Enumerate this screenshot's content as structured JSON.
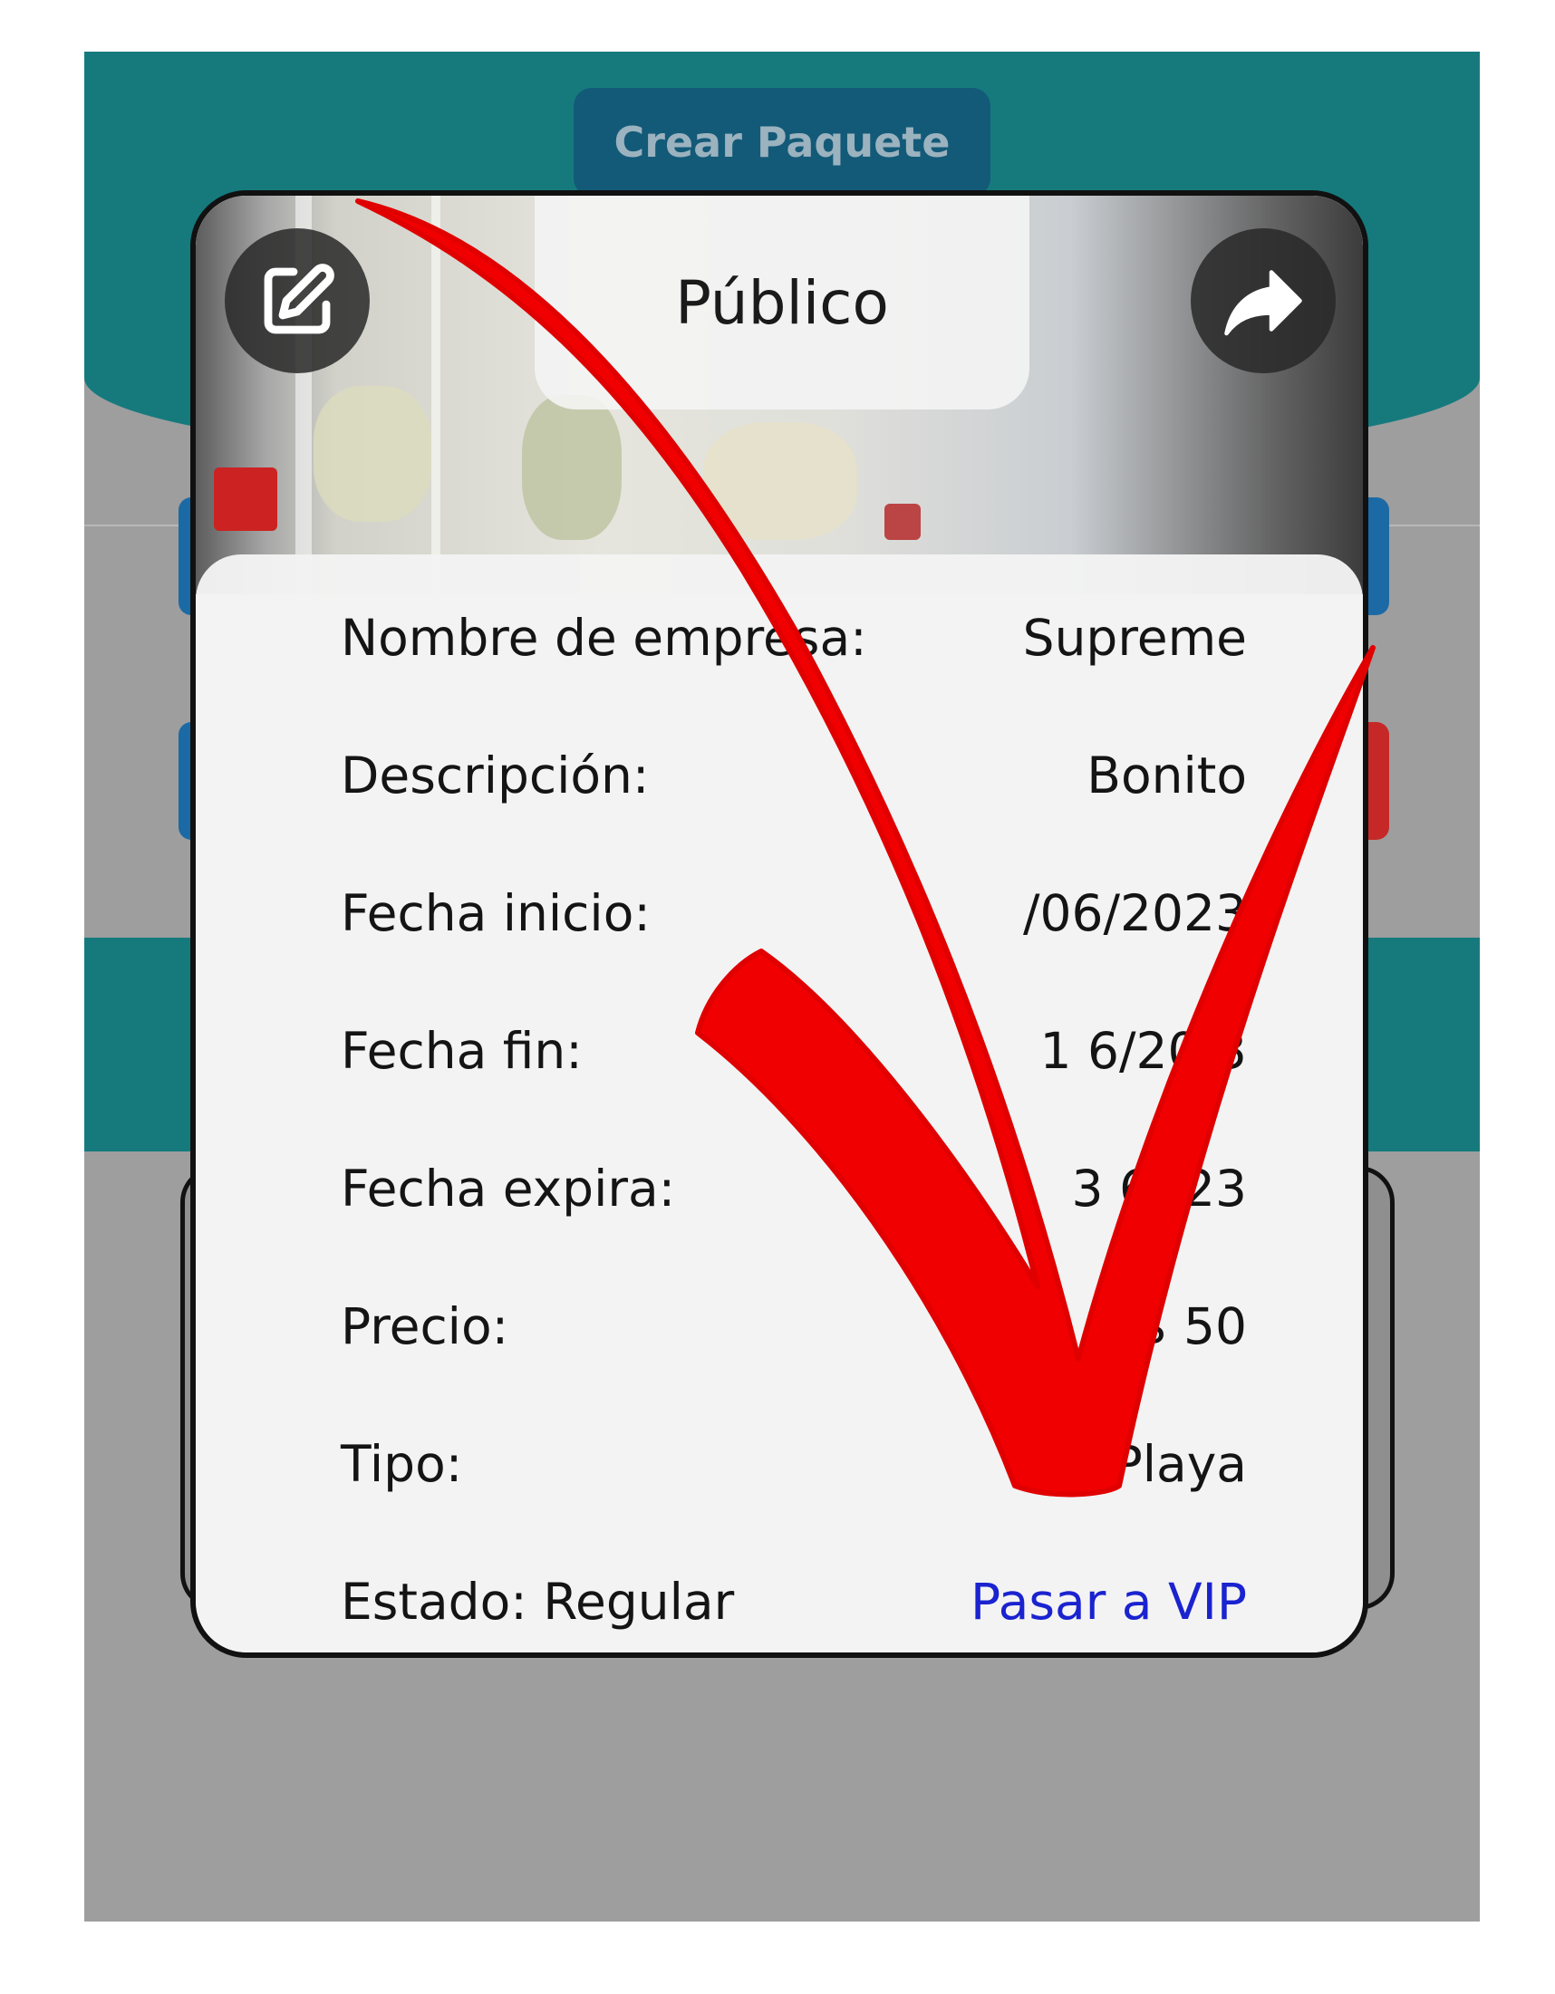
{
  "header": {
    "create_button_label": "Crear Paquete"
  },
  "card": {
    "visibility_label": "Público",
    "edit_icon": "edit-icon",
    "share_icon": "share-icon",
    "fields": [
      {
        "label": "Nombre de empresa:",
        "value": "Supreme"
      },
      {
        "label": "Descripción:",
        "value": "Bonito"
      },
      {
        "label": "Fecha inicio:",
        "value": "/06/2023"
      },
      {
        "label": "Fecha fin:",
        "value": "1 6/20 3"
      },
      {
        "label": "Fecha expira:",
        "value": "3 6/ 23"
      },
      {
        "label": "Precio:",
        "value": "$ 50"
      },
      {
        "label": "Tipo:",
        "value": "Playa"
      }
    ],
    "status_text": "Estado: Regular",
    "vip_link": "Pasar a VIP"
  },
  "colors": {
    "teal": "#167a7d",
    "button_blue": "#135a78",
    "link_blue": "#1a23cf",
    "arrow_red": "#f00000"
  }
}
